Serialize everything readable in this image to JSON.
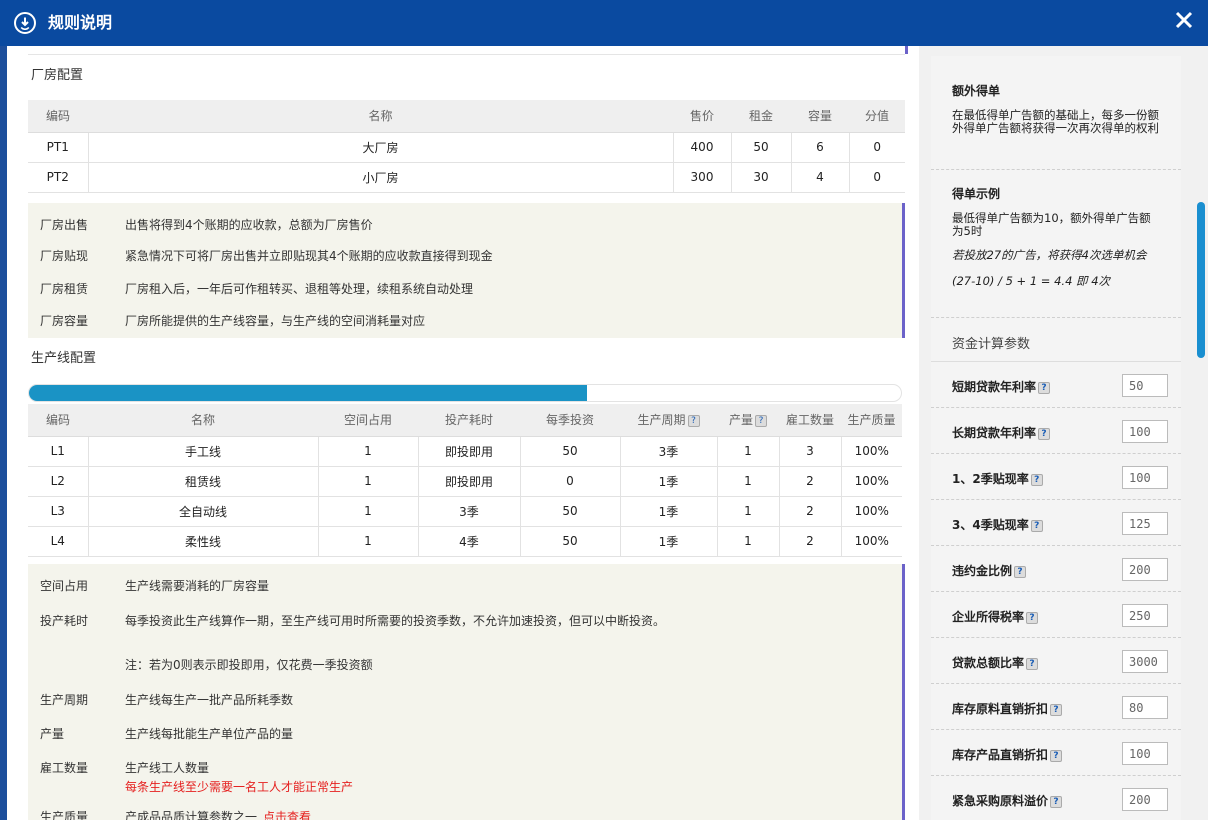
{
  "window": {
    "title": "规则说明",
    "logo_icon": "refresh-circle-icon",
    "close_icon": "close-icon"
  },
  "factory": {
    "section_title": "厂房配置",
    "columns": [
      "编码",
      "名称",
      "售价",
      "租金",
      "容量",
      "分值"
    ],
    "rows": [
      [
        "PT1",
        "大厂房",
        "400",
        "50",
        "6",
        "0"
      ],
      [
        "PT2",
        "小厂房",
        "300",
        "30",
        "4",
        "0"
      ]
    ],
    "notes": [
      {
        "k": "厂房出售",
        "v": "出售将得到4个账期的应收款，总额为厂房售价"
      },
      {
        "k": "厂房贴现",
        "v": "紧急情况下可将厂房出售并立即贴现其4个账期的应收款直接得到现金"
      },
      {
        "k": "厂房租赁",
        "v": "厂房租入后，一年后可作租转买、退租等处理，续租系统自动处理"
      },
      {
        "k": "厂房容量",
        "v": "厂房所能提供的生产线容量，与生产线的空间消耗量对应"
      }
    ]
  },
  "line": {
    "section_title": "生产线配置",
    "progress_fraction": 0.64,
    "columns": [
      "编码",
      "名称",
      "空间占用",
      "投产耗时",
      "每季投资",
      "生产周期",
      "产量",
      "雇工数量",
      "生产质量"
    ],
    "help_cols": [
      5,
      6
    ],
    "rows": [
      [
        "L1",
        "手工线",
        "1",
        "即投即用",
        "50",
        "3季",
        "1",
        "3",
        "100%"
      ],
      [
        "L2",
        "租赁线",
        "1",
        "即投即用",
        "0",
        "1季",
        "1",
        "2",
        "100%"
      ],
      [
        "L3",
        "全自动线",
        "1",
        "3季",
        "50",
        "1季",
        "1",
        "2",
        "100%"
      ],
      [
        "L4",
        "柔性线",
        "1",
        "4季",
        "50",
        "1季",
        "1",
        "2",
        "100%"
      ]
    ],
    "notes": {
      "space": {
        "k": "空间占用",
        "v": "生产线需要消耗的厂房容量"
      },
      "build": {
        "k": "投产耗时",
        "v": "每季投资此生产线算作一期，至生产线可用时所需要的投资季数，不允许加速投资，但可以中断投资。",
        "note": "注：若为0则表示即投即用，仅花费一季投资额"
      },
      "cycle": {
        "k": "生产周期",
        "v": "生产线每生产一批产品所耗季数"
      },
      "output": {
        "k": "产量",
        "v": "生产线每批能生产单位产品的量"
      },
      "workers": {
        "k": "雇工数量",
        "v": "生产线工人数量",
        "red": "每条生产线至少需要一名工人才能正常生产"
      },
      "quality": {
        "k": "生产质量",
        "v": "产成品品质计算参数之一",
        "red": "点击查看"
      }
    }
  },
  "right": {
    "extra": {
      "head": "额外得单",
      "body": "在最低得单广告额的基础上，每多一份额外得单广告额将获得一次再次得单的权利"
    },
    "example": {
      "head": "得单示例",
      "body": "最低得单广告额为10，额外得单广告额为5时",
      "i1": "若投放27的广告，将获得4次选单机会",
      "i2": "(27-10) / 5 + 1 = 4.4 即 4次"
    },
    "fund_title": "资金计算参数",
    "params": [
      {
        "label": "短期贷款年利率",
        "value": "50"
      },
      {
        "label": "长期贷款年利率",
        "value": "100"
      },
      {
        "label": "1、2季贴现率",
        "value": "100"
      },
      {
        "label": "3、4季贴现率",
        "value": "125"
      },
      {
        "label": "违约金比例",
        "value": "200"
      },
      {
        "label": "企业所得税率",
        "value": "250"
      },
      {
        "label": "贷款总额比率",
        "value": "3000"
      },
      {
        "label": "库存原料直销折扣",
        "value": "80"
      },
      {
        "label": "库存产品直销折扣",
        "value": "100"
      },
      {
        "label": "紧急采购原料溢价",
        "value": "200"
      }
    ],
    "help_icon": "help-icon",
    "help_glyph": "?"
  },
  "colors": {
    "titlebar": "#0a4aa0",
    "accent_bar": "#6b62c9",
    "progress": "#1a93c5",
    "red_text": "#e5201f",
    "scrollbar": "#1a8fd0"
  }
}
